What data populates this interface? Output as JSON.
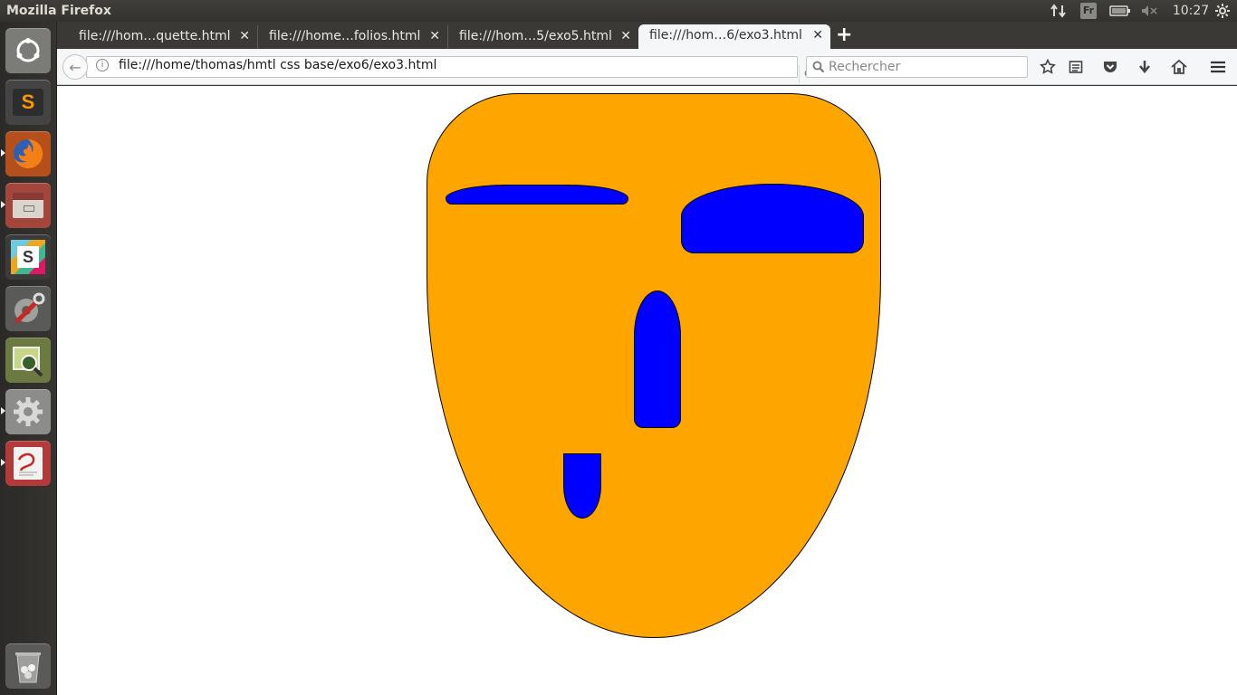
{
  "top_panel": {
    "app_title": "Mozilla Firefox",
    "keyboard_layout": "Fr",
    "clock": "10:27",
    "icons": [
      "network-transfer-icon",
      "battery-icon",
      "volume-muted-icon",
      "settings-gear-icon"
    ]
  },
  "launcher": {
    "items": [
      {
        "name": "ubuntu-dash-icon",
        "bg": "#7b7b78"
      },
      {
        "name": "sublime-text-icon",
        "bg": "#3d3d3d"
      },
      {
        "name": "firefox-icon",
        "bg": "#b54a19"
      },
      {
        "name": "files-icon",
        "bg": "#a3473e"
      },
      {
        "name": "slack-icon",
        "bg": "#3b3b3b"
      },
      {
        "name": "system-tools-icon",
        "bg": "#5a5a58"
      },
      {
        "name": "image-viewer-icon",
        "bg": "#6c7a42"
      },
      {
        "name": "system-settings-icon",
        "bg": "#8c8c8a"
      },
      {
        "name": "document-viewer-icon",
        "bg": "#b23a3a"
      },
      {
        "name": "trash-icon",
        "bg": "#5a5a58"
      }
    ]
  },
  "tabs": [
    {
      "label": "file:///hom…quette.html",
      "close": "✕",
      "active": false
    },
    {
      "label": "file:///home…folios.html",
      "close": "✕",
      "active": false
    },
    {
      "label": "file:///hom…5/exo5.html",
      "close": "✕",
      "active": false
    },
    {
      "label": "file:///hom…6/exo3.html",
      "close": "✕",
      "active": true
    }
  ],
  "new_tab_label": "+",
  "nav": {
    "url": "file:///home/thomas/hmtl css base/exo6/exo3.html",
    "search_placeholder": "Rechercher",
    "toolbar_icons": [
      "bookmark-star-icon",
      "reading-list-icon",
      "pocket-icon",
      "downloads-icon",
      "home-icon",
      "menu-icon"
    ]
  },
  "page": {
    "colors": {
      "face": "#ffa500",
      "features": "#0000ff",
      "outline": "#000000",
      "background": "#ffffff"
    }
  }
}
